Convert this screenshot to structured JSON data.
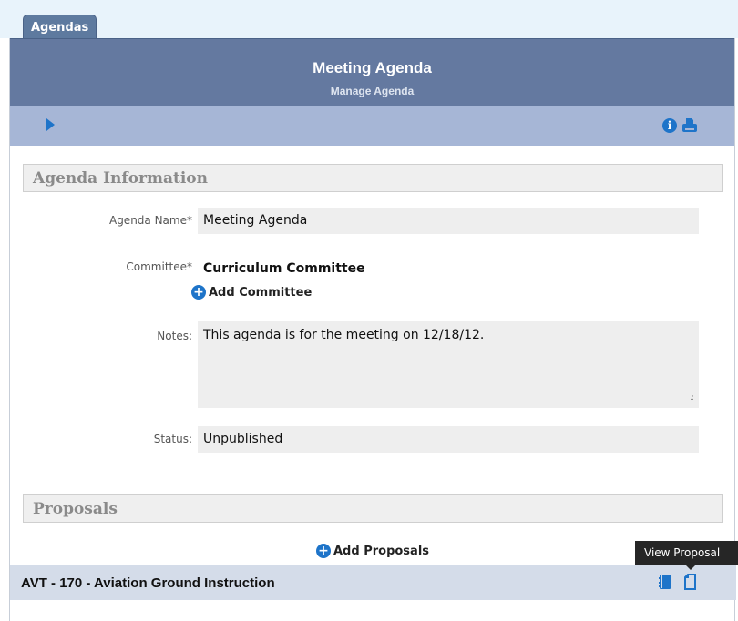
{
  "tab": {
    "label": "Agendas"
  },
  "header": {
    "title": "Meeting Agenda",
    "subtitle": "Manage Agenda"
  },
  "toolbar": {
    "icons": [
      "play-icon",
      "info-icon",
      "print-icon"
    ],
    "accent": "#1e74c9"
  },
  "agenda_info": {
    "heading": "Agenda Information",
    "name_label": "Agenda Name*",
    "name_value": "Meeting Agenda",
    "committee_label": "Committee*",
    "committee_value": "Curriculum Committee",
    "add_committee": "Add Committee",
    "notes_label": "Notes:",
    "notes_value": "This agenda is for the meeting on 12/18/12.",
    "status_label": "Status:",
    "status_value": "Unpublished"
  },
  "proposals": {
    "heading": "Proposals",
    "add_label": "Add Proposals",
    "items": [
      {
        "name": "AVT - 170 - Aviation Ground Instruction"
      }
    ],
    "tooltip": "View Proposal"
  },
  "colors": {
    "header": "#6479a0",
    "toolbar": "#a6b6d6",
    "row": "#d4dce9"
  }
}
